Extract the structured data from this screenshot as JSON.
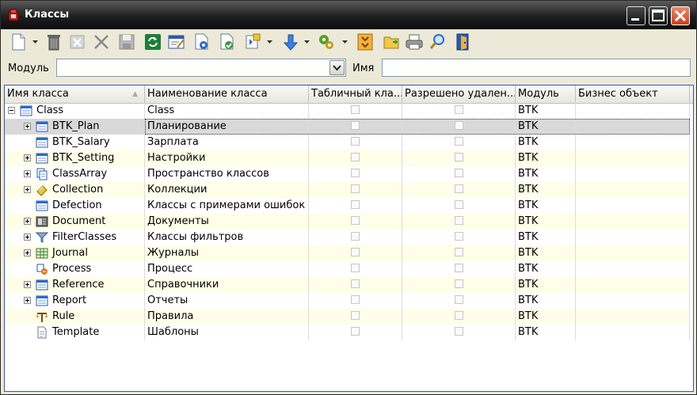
{
  "window": {
    "title": "Классы"
  },
  "filter": {
    "module_label": "Модуль",
    "module_value": "",
    "name_label": "Имя",
    "name_value": ""
  },
  "columns": [
    {
      "label": "Имя класса"
    },
    {
      "label": "Наименование класса"
    },
    {
      "label": "Табличный кла..."
    },
    {
      "label": "Разрешено удален..."
    },
    {
      "label": "Модуль"
    },
    {
      "label": "Бизнес объект"
    }
  ],
  "rows": [
    {
      "name": "Class",
      "title": "Class",
      "module": "BTK",
      "level": 0,
      "expander": "minus",
      "icon": "class-icon"
    },
    {
      "name": "BTK_Plan",
      "title": "Планирование",
      "module": "BTK",
      "level": 1,
      "expander": "plus",
      "icon": "class-icon",
      "selected": true
    },
    {
      "name": "BTK_Salary",
      "title": "Зарплата",
      "module": "BTK",
      "level": 1,
      "expander": "none",
      "icon": "class-icon"
    },
    {
      "name": "BTK_Setting",
      "title": "Настройки",
      "module": "BTK",
      "level": 1,
      "expander": "plus",
      "icon": "class-icon"
    },
    {
      "name": "ClassArray",
      "title": "Пространство классов",
      "module": "BTK",
      "level": 1,
      "expander": "plus",
      "icon": "pages-icon"
    },
    {
      "name": "Collection",
      "title": "Коллекции",
      "module": "BTK",
      "level": 1,
      "expander": "plus",
      "icon": "collection-icon"
    },
    {
      "name": "Defection",
      "title": "Классы с примерами ошибок",
      "module": "BTK",
      "level": 1,
      "expander": "none",
      "icon": "class-icon"
    },
    {
      "name": "Document",
      "title": "Документы",
      "module": "BTK",
      "level": 1,
      "expander": "plus",
      "icon": "document-icon"
    },
    {
      "name": "FilterClasses",
      "title": "Классы фильтров",
      "module": "BTK",
      "level": 1,
      "expander": "plus",
      "icon": "filter-icon"
    },
    {
      "name": "Journal",
      "title": "Журналы",
      "module": "BTK",
      "level": 1,
      "expander": "plus",
      "icon": "journal-icon"
    },
    {
      "name": "Process",
      "title": "Процесс",
      "module": "BTK",
      "level": 1,
      "expander": "none",
      "icon": "process-icon"
    },
    {
      "name": "Reference",
      "title": "Справочники",
      "module": "BTK",
      "level": 1,
      "expander": "plus",
      "icon": "class-icon"
    },
    {
      "name": "Report",
      "title": "Отчеты",
      "module": "BTK",
      "level": 1,
      "expander": "plus",
      "icon": "class-icon"
    },
    {
      "name": "Rule",
      "title": "Правила",
      "module": "BTK",
      "level": 1,
      "expander": "none",
      "icon": "rule-icon"
    },
    {
      "name": "Template",
      "title": "Шаблоны",
      "module": "BTK",
      "level": 1,
      "expander": "none",
      "icon": "template-icon"
    }
  ],
  "toolbar": [
    {
      "icon": "new-document-icon",
      "dropdown": true
    },
    {
      "icon": "trash-icon"
    },
    {
      "icon": "close-box-icon"
    },
    {
      "icon": "delete-x-icon"
    },
    {
      "icon": "save-icon"
    },
    {
      "icon": "refresh-icon"
    },
    {
      "icon": "edit-icon"
    },
    {
      "icon": "document-settings-icon"
    },
    {
      "icon": "document-check-icon"
    },
    {
      "icon": "export-icon",
      "dropdown": true
    },
    {
      "icon": "arrow-down-icon",
      "dropdown": true
    },
    {
      "icon": "tools-icon",
      "dropdown": true
    },
    {
      "icon": "move-icon"
    },
    {
      "icon": "folder-open-icon"
    },
    {
      "icon": "print-icon"
    },
    {
      "icon": "find-icon"
    },
    {
      "icon": "exit-icon"
    }
  ],
  "colors": {
    "row_alt": "#fffee8",
    "row_selected": "#d9d9d9",
    "grid_border": "#3b55a5",
    "panel": "#ece9d8"
  }
}
